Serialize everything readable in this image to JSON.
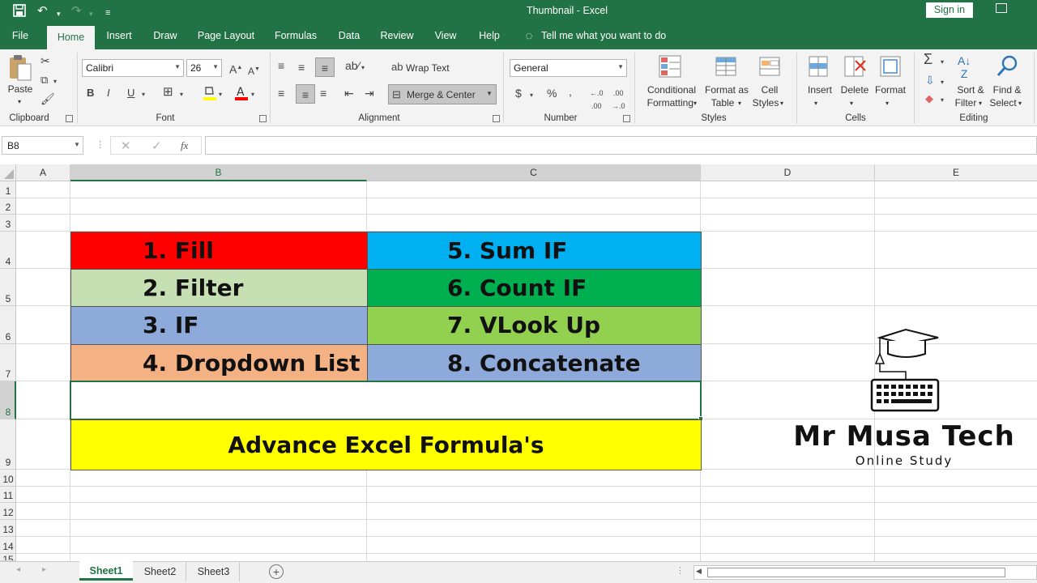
{
  "title_bar": {
    "title": "Thumbnail  -  Excel",
    "sign_in": "Sign in"
  },
  "menu": {
    "items": [
      "File",
      "Home",
      "Insert",
      "Draw",
      "Page Layout",
      "Formulas",
      "Data",
      "Review",
      "View",
      "Help"
    ],
    "tell_me": "Tell me what you want to do"
  },
  "ribbon": {
    "clipboard": {
      "paste": "Paste",
      "label": "Clipboard"
    },
    "font": {
      "name": "Calibri",
      "size": "26",
      "label": "Font"
    },
    "alignment": {
      "wrap_text": "Wrap Text",
      "merge_center": "Merge & Center",
      "label": "Alignment"
    },
    "number": {
      "format": "General",
      "label": "Number"
    },
    "styles": {
      "conditional": "Conditional",
      "formatting": "Formatting",
      "format_as": "Format as",
      "table": "Table",
      "cell": "Cell",
      "styles": "Styles",
      "label": "Styles"
    },
    "cells": {
      "insert": "Insert",
      "delete": "Delete",
      "format": "Format",
      "label": "Cells"
    },
    "editing": {
      "sort": "Sort &",
      "filter": "Filter",
      "find": "Find &",
      "select": "Select",
      "label": "Editing"
    }
  },
  "formula_bar": {
    "name_box": "B8",
    "fx": "fx",
    "value": ""
  },
  "columns": [
    "A",
    "B",
    "C",
    "D",
    "E"
  ],
  "rows": [
    "1",
    "2",
    "3",
    "4",
    "5",
    "6",
    "7",
    "8",
    "9",
    "10",
    "11",
    "12",
    "13",
    "14",
    "15"
  ],
  "cells": {
    "b4": "1. Fill",
    "c4": "5. Sum IF",
    "b5": "2. Filter",
    "c5": "6. Count IF",
    "b6": "3. IF",
    "c6": "7. VLook Up",
    "b7": "4. Dropdown List",
    "c7": "8. Concatenate",
    "b9": "Advance Excel Formula's"
  },
  "colors": {
    "excel_green": "#217346",
    "red": "#ff0000",
    "sky": "#00b0f0",
    "light_green": "#c6e0b4",
    "green": "#00b050",
    "blue_grey": "#8eaadb",
    "lime": "#92d050",
    "salmon": "#f4b183",
    "yellow": "#ffff00"
  },
  "logo": {
    "title": "Mr Musa Tech",
    "subtitle": "Online Study"
  },
  "sheets": [
    "Sheet1",
    "Sheet2",
    "Sheet3"
  ]
}
